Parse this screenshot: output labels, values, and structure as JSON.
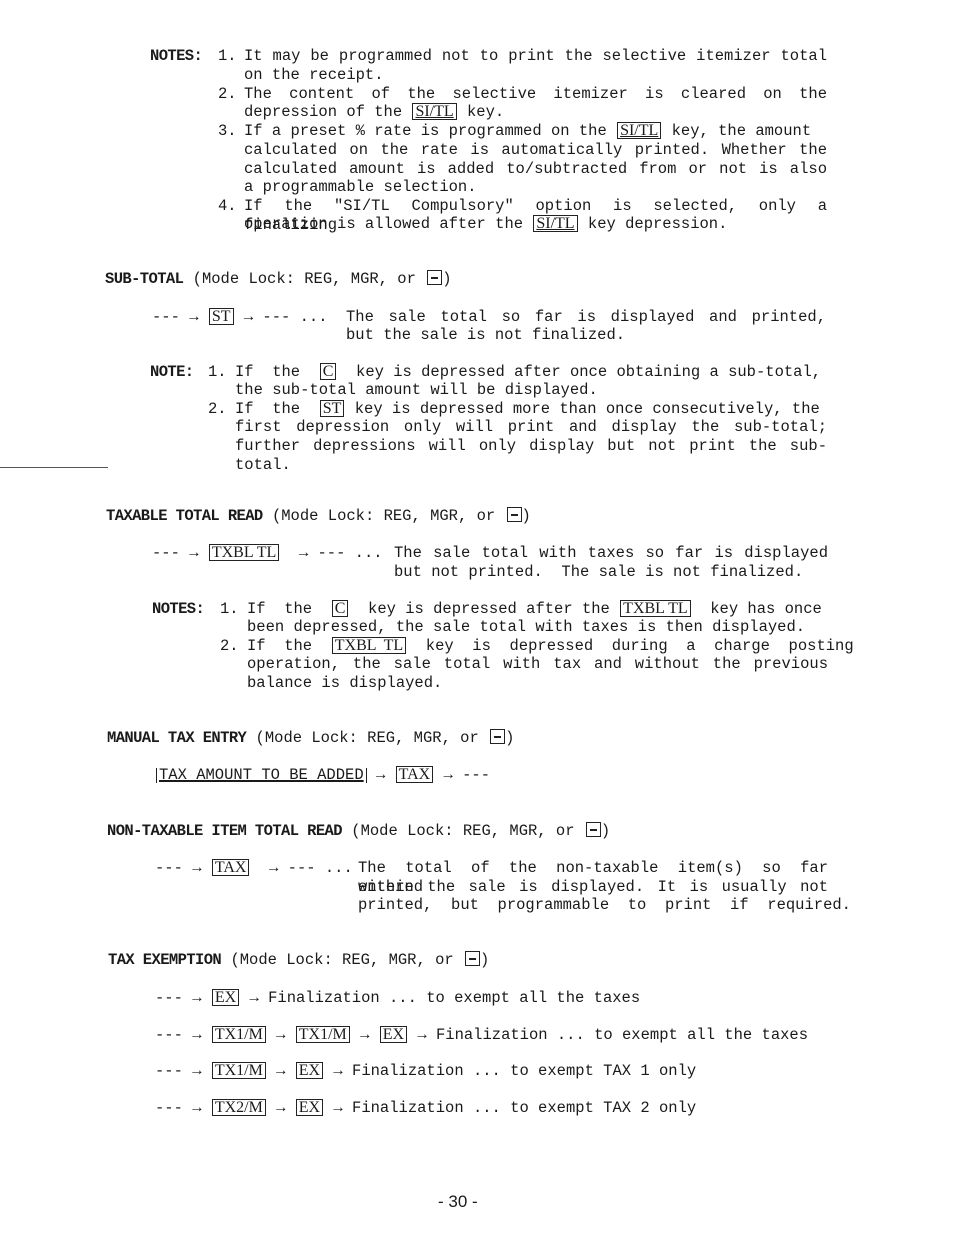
{
  "si_tl_notes": {
    "label": "NOTES:",
    "items": [
      {
        "num": "1.",
        "lines": [
          "It may be programmed not to print the selective itemizer total",
          "on the receipt."
        ]
      },
      {
        "num": "2.",
        "lines": [
          "The  content  of  the  selective  itemizer  is  cleared  on  the",
          "depression of the",
          "key."
        ],
        "key": "SI/TL"
      },
      {
        "num": "3.",
        "lines": [
          "If a preset % rate is programmed on the",
          "key, the amount",
          "calculated  on  the  rate  is  automatically  printed.   Whether  the",
          "calculated  amount  is  added  to/subtracted  from  or  not  is  also",
          "a programmable selection."
        ],
        "key": "SI/TL"
      },
      {
        "num": "4.",
        "lines": [
          "If the \"SI/TL Compulsory\" option is selected, only a finalizing",
          "operation is allowed after the",
          "key depression."
        ],
        "key": "SI/TL"
      }
    ]
  },
  "sub_total": {
    "title": "SUB-TOTAL",
    "mode_lock": "(Mode Lock: REG, MGR, or",
    "close_paren": ")",
    "seq_prefix": "--- →",
    "key": "ST",
    "seq_suffix": "→ --- ...",
    "desc": [
      "The  sale  total  so  far  is  displayed  and  printed,",
      "but the sale is not finalized."
    ],
    "note_label": "NOTE:",
    "notes": [
      {
        "num": "1.",
        "pre": "If  the",
        "key": "C",
        "post": "key is depressed after once obtaining a sub-total,",
        "cont": [
          "the sub-total amount will be displayed."
        ]
      },
      {
        "num": "2.",
        "pre": "If  the",
        "key": "ST",
        "post": "key is depressed more than once consecutively, the",
        "cont": [
          "first  depression  only  will  print  and  display  the  sub-total;",
          "further  depressions  will  only  display  but  not  print  the  sub-",
          "total."
        ]
      }
    ]
  },
  "taxable_total": {
    "title": "TAXABLE TOTAL READ",
    "mode_lock": "(Mode Lock: REG, MGR, or",
    "close_paren": ")",
    "seq_prefix": "--- →",
    "key": "TXBL TL",
    "seq_suffix": "→ --- ...",
    "desc": [
      "The  sale  total  with  taxes  so  far  is  displayed",
      "but not printed.  The sale is not finalized."
    ],
    "note_label": "NOTES:",
    "notes": [
      {
        "num": "1.",
        "pre": "If  the",
        "key": "C",
        "mid": "key is depressed after the",
        "key2": "TXBL TL",
        "post": "key has once",
        "cont": [
          "been depressed, the sale total with taxes is then displayed."
        ]
      },
      {
        "num": "2.",
        "pre": "If  the",
        "key": "TXBL  TL",
        "post": "key  is  depressed  during  a  charge  posting",
        "cont": [
          "operation,  the  sale  total  with  tax  and  without  the  previous",
          "balance is displayed."
        ]
      }
    ]
  },
  "manual_tax": {
    "title": "MANUAL TAX ENTRY",
    "mode_lock": "(Mode Lock: REG, MGR, or",
    "close_paren": ")",
    "entry": "TAX AMOUNT TO BE ADDED",
    "arrow": "→",
    "key": "TAX",
    "suffix": "→ ---"
  },
  "non_taxable": {
    "title": "NON-TAXABLE ITEM TOTAL READ",
    "mode_lock": "(Mode Lock: REG, MGR, or",
    "close_paren": ")",
    "seq_prefix": "--- →",
    "key": "TAX",
    "seq_suffix": "→ --- ...",
    "desc": [
      "The  total  of  the  non-taxable  item(s)  so  far  entered",
      "within  the  sale  is  displayed.   It  is  usually  not",
      "printed,  but  programmable  to  print  if  required."
    ]
  },
  "tax_exemption": {
    "title": "TAX EXEMPTION",
    "mode_lock": "(Mode Lock: REG, MGR, or",
    "close_paren": ")",
    "dash": "---",
    "arrow": "→",
    "rows": [
      {
        "keys": [
          "EX"
        ],
        "text": "→ Finalization ... to exempt all the taxes"
      },
      {
        "keys": [
          "TX1/M",
          "TX1/M",
          "EX"
        ],
        "text": "→ Finalization ... to exempt all the taxes"
      },
      {
        "keys": [
          "TX1/M",
          "EX"
        ],
        "text": "→ Finalization ... to exempt TAX 1 only"
      },
      {
        "keys": [
          "TX2/M",
          "EX"
        ],
        "text": "→ Finalization ... to exempt TAX 2 only"
      }
    ]
  },
  "page_number": "- 30 -"
}
